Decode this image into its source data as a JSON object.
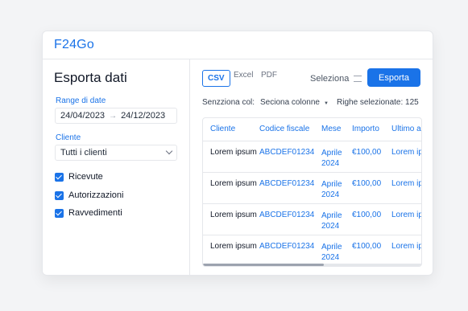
{
  "app": {
    "logo": "F24Go"
  },
  "sidebar": {
    "title": "Esporta dati",
    "date_range": {
      "label": "Range di date",
      "from": "24/04/2023",
      "arrow": "→",
      "to": "24/12/2023"
    },
    "client": {
      "label": "Cliente",
      "value": "Tutti i clienti"
    },
    "checkboxes": [
      {
        "label": "Ricevute",
        "checked": true
      },
      {
        "label": "Autorizzazioni",
        "checked": true
      },
      {
        "label": "Ravvedimenti",
        "checked": true
      }
    ]
  },
  "main": {
    "formats": [
      "CSV",
      "Excel",
      "PDF"
    ],
    "active_format": "CSV",
    "select_label": "Seleziona",
    "export_label": "Esporta",
    "columns_label": "Senzziona col:",
    "columns_select": "Seciona colonne",
    "selected_rows": "Righe selezionate: 125",
    "table": {
      "headers": [
        "Cliente",
        "Codice fiscale",
        "Mese",
        "Importo",
        "Ultimo a"
      ],
      "rows": [
        {
          "client": "Lorem ipsum",
          "code": "ABCDEF01234",
          "month": "Aprile 2024",
          "month_1": "Aprile",
          "month_2": "2024",
          "amount": "€100,00",
          "last": "Lorem ip"
        },
        {
          "client": "Lorem ipsum",
          "code": "ABCDEF01234",
          "month": "Aprile 2024",
          "month_1": "Aprile",
          "month_2": "2024",
          "amount": "€100,00",
          "last": "Lorem ip"
        },
        {
          "client": "Lorem ipsum",
          "code": "ABCDEF01234",
          "month": "Aprile 2024",
          "month_1": "Aprile",
          "month_2": "2024",
          "amount": "€100,00",
          "last": "Lorem ip"
        },
        {
          "client": "Lorem ipsum",
          "code": "ABCDEF01234",
          "month": "Aprile 2024",
          "month_1": "Aprile",
          "month_2": "2024",
          "amount": "€100,00",
          "last": "Lorem ip"
        }
      ]
    }
  },
  "colors": {
    "accent": "#1a73e8",
    "text": "#111827",
    "border": "#e5e7eb"
  },
  "icons": {
    "arrow": "arrow-right-icon",
    "chevron": "chevron-down-icon",
    "sliders": "sliders-icon",
    "caret": "caret-down-icon"
  }
}
